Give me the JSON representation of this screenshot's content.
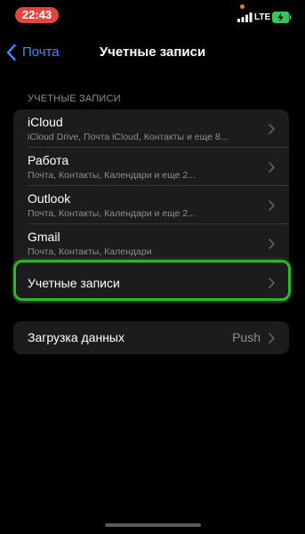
{
  "status_bar": {
    "time": "22:43",
    "network": "LTE",
    "time_pill_color": "#e5453f",
    "battery_charging": true
  },
  "nav": {
    "back_label": "Почта",
    "title": "Учетные записи",
    "accent_color": "#3d8bfd"
  },
  "accounts_section": {
    "header": "УЧЕТНЫЕ ЗАПИСИ",
    "items": [
      {
        "title": "iCloud",
        "subtitle": "iCloud Drive, Почта iCloud, Контакты и еще 8..."
      },
      {
        "title": "Работа",
        "subtitle": "Почта, Контакты, Календари и еще 2..."
      },
      {
        "title": "Outlook",
        "subtitle": "Почта, Контакты, Календари и еще 2..."
      },
      {
        "title": "Gmail",
        "subtitle": "Почта, Контакты, Календари"
      },
      {
        "title": "Учетные записи",
        "subtitle": ""
      }
    ]
  },
  "fetch_section": {
    "title": "Загрузка данных",
    "value": "Push"
  },
  "highlight_color": "#2fb52a"
}
